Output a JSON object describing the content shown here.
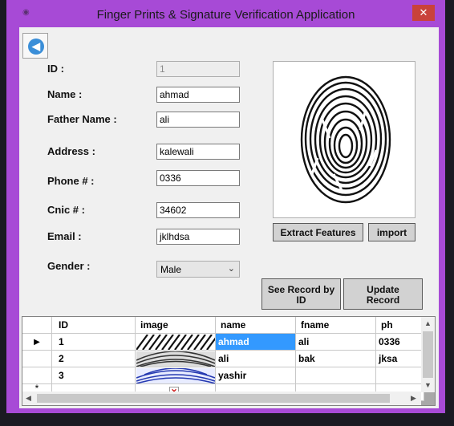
{
  "window": {
    "title": "Finger Prints & Signature Verification Application",
    "close_glyph": "✕"
  },
  "form": {
    "fields": [
      {
        "label": "ID  :",
        "value": "1"
      },
      {
        "label": "Name :",
        "value": "ahmad"
      },
      {
        "label": "Father Name :",
        "value": "ali"
      },
      {
        "label": "Address  :",
        "value": "kalewali"
      },
      {
        "label": "Phone #  :",
        "value": "0336"
      },
      {
        "label": "Cnic #  :",
        "value": "34602"
      },
      {
        "label": "Email  :",
        "value": "jklhdsa"
      }
    ],
    "gender_label": "Gender  :",
    "gender_value": "Male"
  },
  "buttons": {
    "extract": "Extract Features",
    "import": "import",
    "see_record_line1": "See Record by",
    "see_record_line2": "ID",
    "update_line1": "Update",
    "update_line2": "Record"
  },
  "grid": {
    "columns": [
      "ID",
      "image",
      "name",
      "fname",
      "ph"
    ],
    "rows": [
      {
        "id": "1",
        "name": "ahmad",
        "fname": "ali",
        "ph": "0336"
      },
      {
        "id": "2",
        "name": "ali",
        "fname": "bak",
        "ph": "jksa"
      },
      {
        "id": "3",
        "name": "yashir",
        "fname": "",
        "ph": ""
      }
    ],
    "current_row_marker": "▶",
    "new_row_marker": "*"
  },
  "colors": {
    "window_frame": "#a74ad6",
    "selection": "#3399ff",
    "back_button": "#3a8ed8"
  }
}
